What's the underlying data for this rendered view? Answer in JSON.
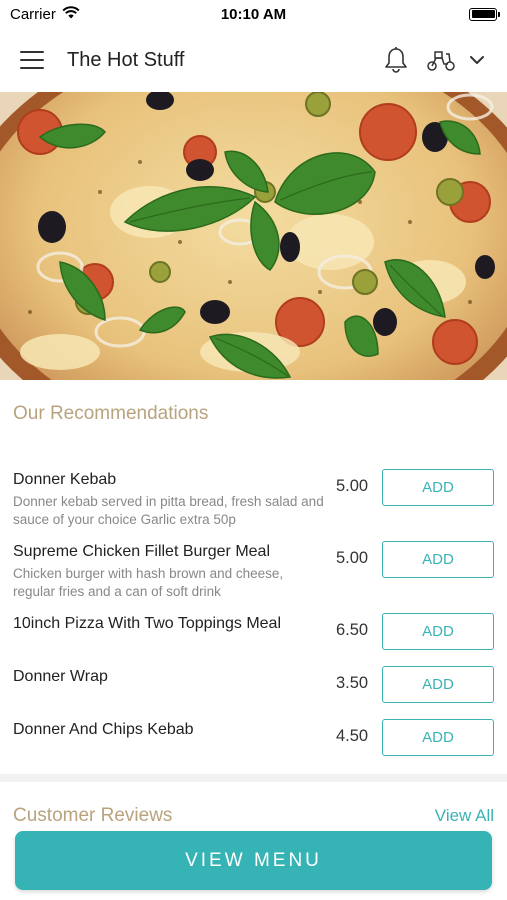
{
  "status_bar": {
    "carrier": "Carrier",
    "time": "10:10 AM"
  },
  "header": {
    "title": "The Hot Stuff",
    "icons": [
      "hamburger-menu-icon",
      "bell-icon",
      "scooter-icon",
      "chevron-down-icon"
    ]
  },
  "hero": {
    "image": "pizza-photo"
  },
  "recommendations": {
    "title": "Our Recommendations",
    "add_label": "ADD",
    "items": [
      {
        "name": "Donner Kebab",
        "description": "Donner kebab served in pitta bread, fresh salad and sauce of your choice Garlic extra 50p",
        "price": "5.00"
      },
      {
        "name": "Supreme Chicken Fillet Burger Meal",
        "description": "Chicken burger with hash brown and cheese, regular fries and a can of soft drink",
        "price": "5.00"
      },
      {
        "name": "10inch Pizza With Two Toppings Meal",
        "description": "",
        "price": "6.50"
      },
      {
        "name": "Donner Wrap",
        "description": "",
        "price": "3.50"
      },
      {
        "name": "Donner And Chips Kebab",
        "description": "",
        "price": "4.50"
      }
    ]
  },
  "reviews": {
    "title": "Customer Reviews",
    "view_all": "View All"
  },
  "footer": {
    "view_menu": "VIEW MENU"
  },
  "colors": {
    "accent": "#35b3b5",
    "section_title": "#b8a37e"
  }
}
